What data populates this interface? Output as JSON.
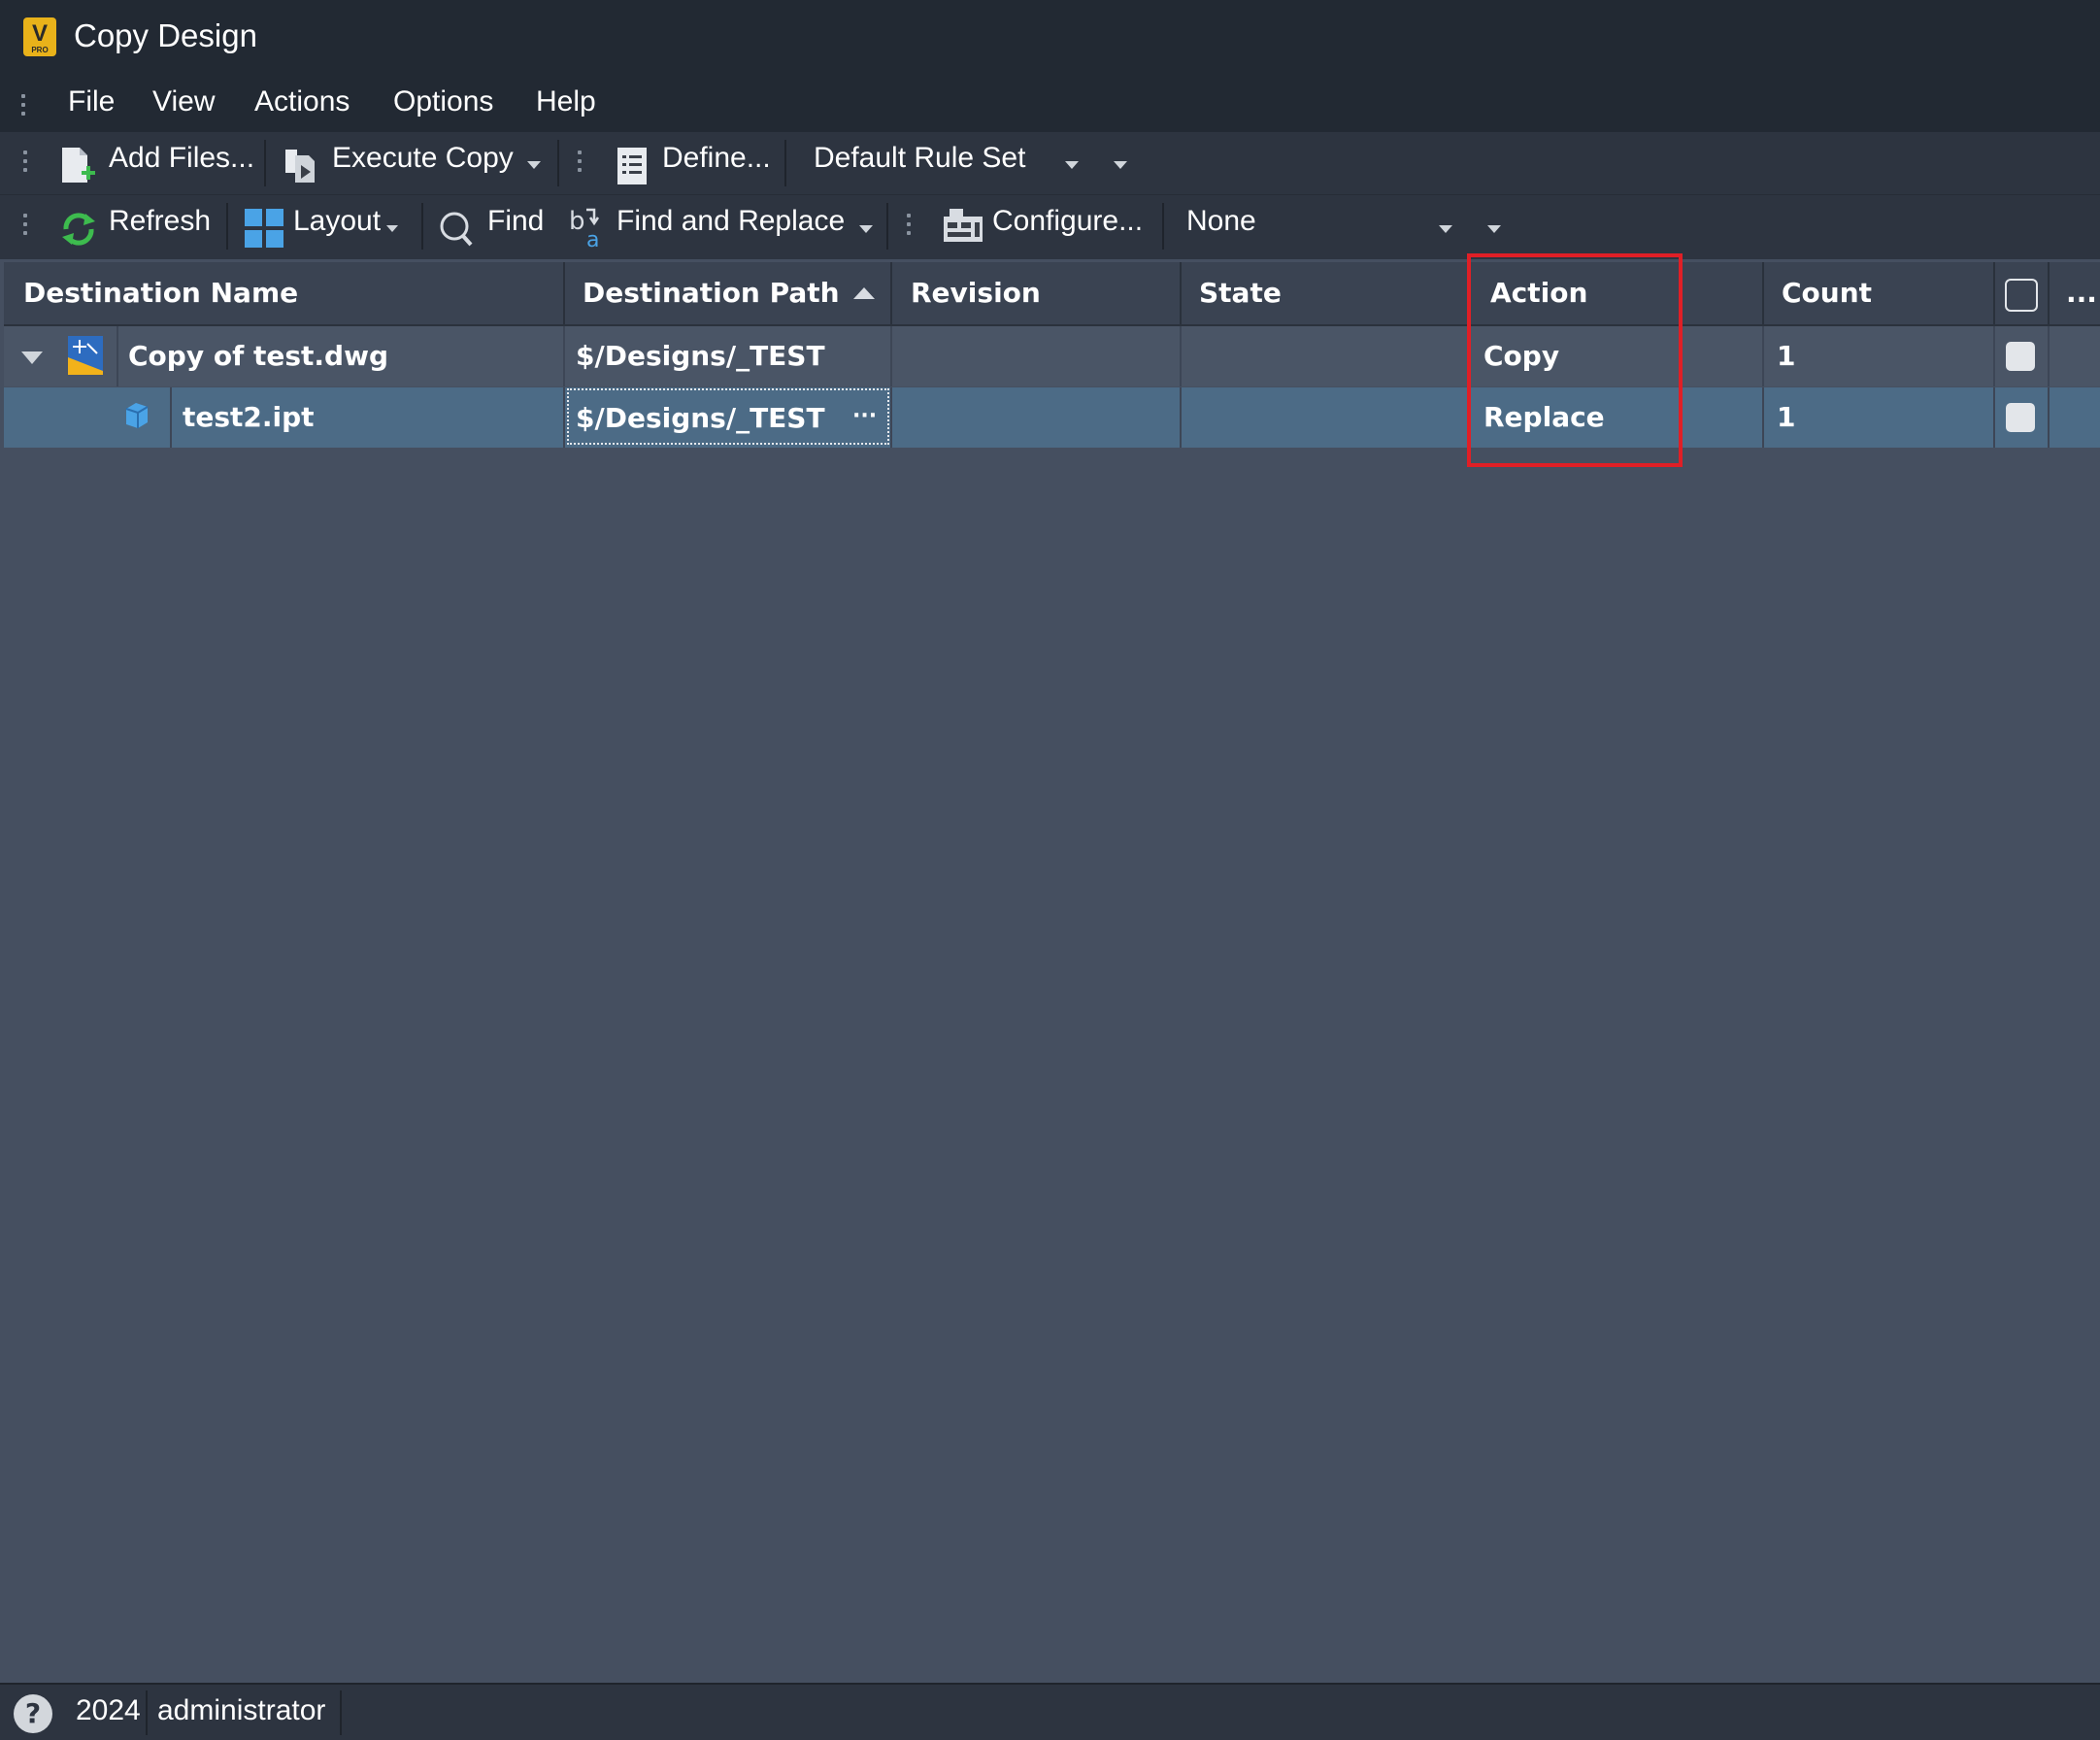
{
  "window": {
    "title": "Copy Design",
    "logo_letter": "V",
    "logo_sub": "PRO"
  },
  "menu": {
    "items": [
      "File",
      "View",
      "Actions",
      "Options",
      "Help"
    ]
  },
  "toolbar1": {
    "add_files": "Add Files...",
    "execute_copy": "Execute Copy",
    "define": "Define...",
    "rule_set": "Default Rule Set"
  },
  "toolbar2": {
    "refresh": "Refresh",
    "layout": "Layout",
    "find": "Find",
    "find_replace": "Find and Replace",
    "configure": "Configure...",
    "filter": "None"
  },
  "grid": {
    "columns": {
      "name": "Destination Name",
      "path": "Destination Path",
      "revision": "Revision",
      "state": "State",
      "action": "Action",
      "count": "Count",
      "more": "..."
    },
    "rows": [
      {
        "name": "Copy of test.dwg",
        "path": "$/Designs/_TEST",
        "revision": "",
        "state": "",
        "action": "Copy",
        "count": "1"
      },
      {
        "name": "test2.ipt",
        "path": "$/Designs/_TEST",
        "revision": "",
        "state": "",
        "action": "Replace",
        "count": "1",
        "path_button": "···"
      }
    ]
  },
  "status": {
    "help": "?",
    "year": "2024",
    "user": "administrator"
  },
  "colors": {
    "accent_highlight": "#e01f26",
    "selected_row": "#4c6b86",
    "background": "#454f60"
  }
}
